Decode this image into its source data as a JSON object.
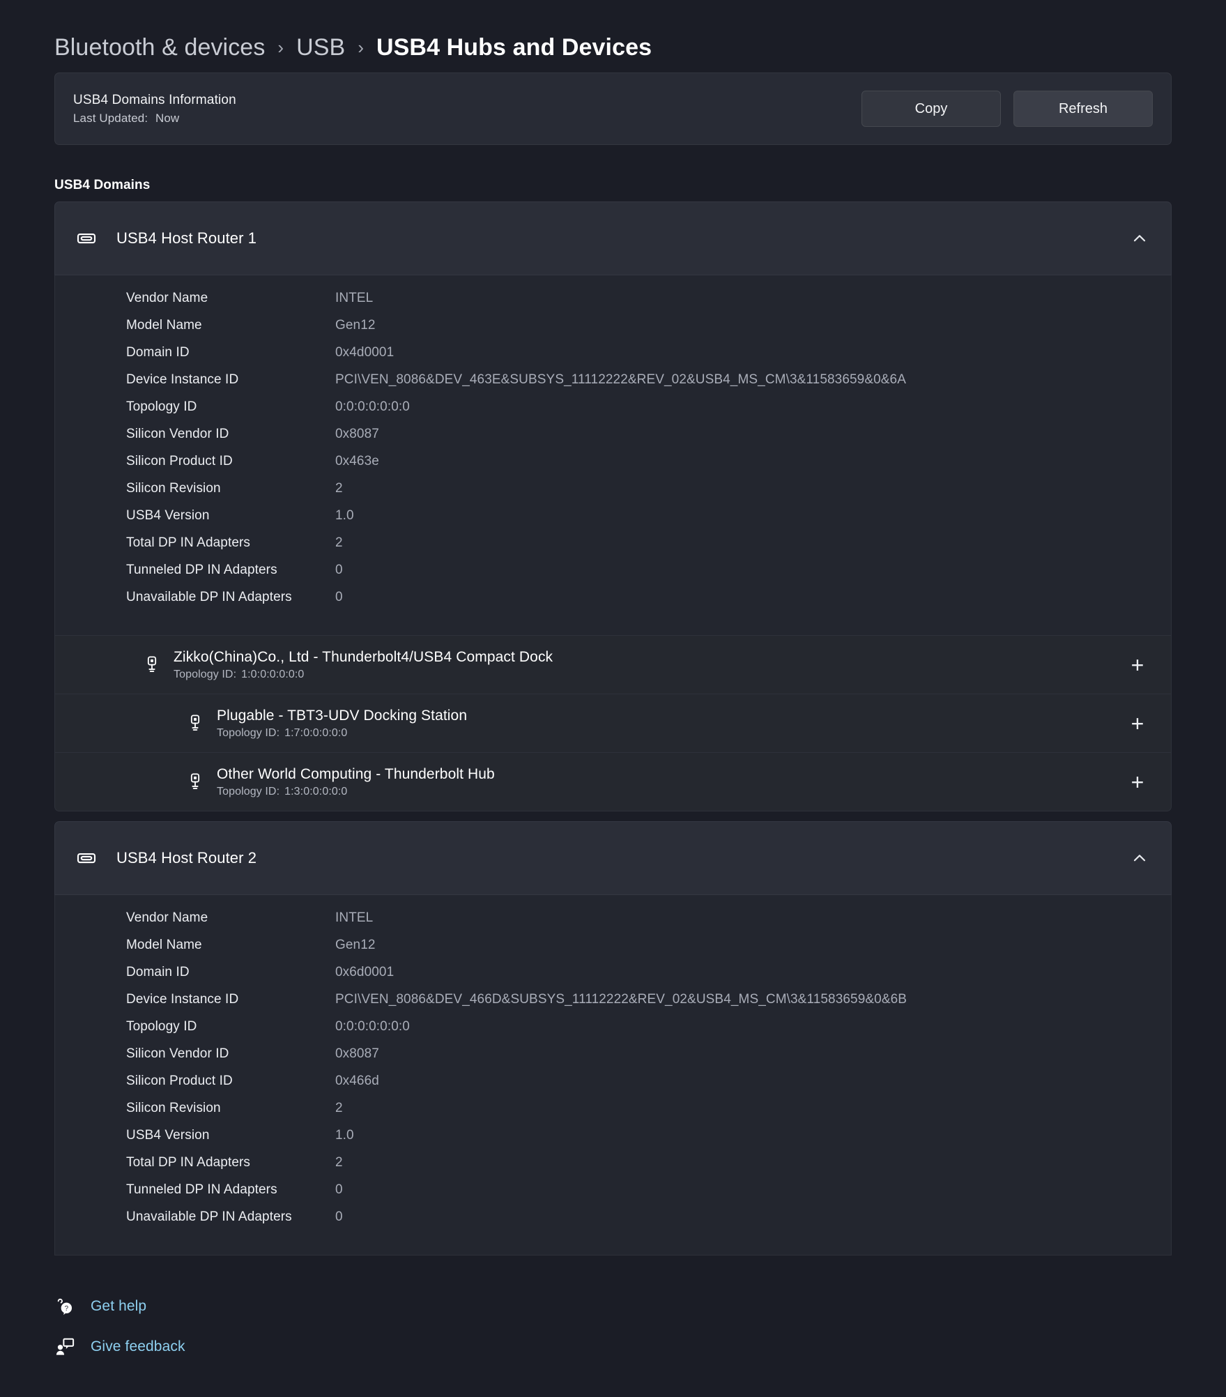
{
  "breadcrumb": {
    "items": [
      {
        "label": "Bluetooth & devices",
        "current": false
      },
      {
        "label": "USB",
        "current": false
      },
      {
        "label": "USB4 Hubs and Devices",
        "current": true
      }
    ],
    "separator": "›"
  },
  "info_card": {
    "title": "USB4 Domains Information",
    "last_updated_label": "Last Updated:",
    "last_updated_value": "Now",
    "copy_button": "Copy",
    "refresh_button": "Refresh"
  },
  "section": {
    "label": "USB4 Domains"
  },
  "routers": [
    {
      "title": "USB4 Host Router 1",
      "icon": "usb-port-icon",
      "expanded": true,
      "details": [
        {
          "key": "Vendor Name",
          "value": "INTEL"
        },
        {
          "key": "Model Name",
          "value": "Gen12"
        },
        {
          "key": "Domain ID",
          "value": "0x4d0001"
        },
        {
          "key": "Device Instance ID",
          "value": "PCI\\VEN_8086&DEV_463E&SUBSYS_11112222&REV_02&USB4_MS_CM\\3&11583659&0&6A"
        },
        {
          "key": "Topology ID",
          "value": "0:0:0:0:0:0:0"
        },
        {
          "key": "Silicon Vendor ID",
          "value": "0x8087"
        },
        {
          "key": "Silicon Product ID",
          "value": "0x463e"
        },
        {
          "key": "Silicon Revision",
          "value": "2"
        },
        {
          "key": "USB4 Version",
          "value": "1.0"
        },
        {
          "key": "Total DP IN Adapters",
          "value": "2"
        },
        {
          "key": "Tunneled DP IN Adapters",
          "value": "0"
        },
        {
          "key": "Unavailable DP IN Adapters",
          "value": "0"
        }
      ],
      "devices": [
        {
          "name": "Zikko(China)Co., Ltd - Thunderbolt4/USB4 Compact Dock",
          "topology_label": "Topology ID:",
          "topology_value": "1:0:0:0:0:0:0",
          "indent": 0,
          "expand_icon": "+"
        },
        {
          "name": "Plugable - TBT3-UDV Docking Station",
          "topology_label": "Topology ID:",
          "topology_value": "1:7:0:0:0:0:0",
          "indent": 1,
          "expand_icon": "+"
        },
        {
          "name": "Other World Computing - Thunderbolt Hub",
          "topology_label": "Topology ID:",
          "topology_value": "1:3:0:0:0:0:0",
          "indent": 1,
          "expand_icon": "+"
        }
      ]
    },
    {
      "title": "USB4 Host Router 2",
      "icon": "usb-port-icon",
      "expanded": true,
      "details": [
        {
          "key": "Vendor Name",
          "value": "INTEL"
        },
        {
          "key": "Model Name",
          "value": "Gen12"
        },
        {
          "key": "Domain ID",
          "value": "0x6d0001"
        },
        {
          "key": "Device Instance ID",
          "value": "PCI\\VEN_8086&DEV_466D&SUBSYS_11112222&REV_02&USB4_MS_CM\\3&11583659&0&6B"
        },
        {
          "key": "Topology ID",
          "value": "0:0:0:0:0:0:0"
        },
        {
          "key": "Silicon Vendor ID",
          "value": "0x8087"
        },
        {
          "key": "Silicon Product ID",
          "value": "0x466d"
        },
        {
          "key": "Silicon Revision",
          "value": "2"
        },
        {
          "key": "USB4 Version",
          "value": "1.0"
        },
        {
          "key": "Total DP IN Adapters",
          "value": "2"
        },
        {
          "key": "Tunneled DP IN Adapters",
          "value": "0"
        },
        {
          "key": "Unavailable DP IN Adapters",
          "value": "0"
        }
      ],
      "devices": []
    }
  ],
  "footer": {
    "links": [
      {
        "label": "Get help",
        "icon": "help-question-icon"
      },
      {
        "label": "Give feedback",
        "icon": "feedback-person-chat-icon"
      }
    ]
  },
  "colors": {
    "page_background": "#1b1d26",
    "card_background": "#282b35",
    "details_background": "#23262f",
    "accent_link": "#8ed0f0",
    "primary_text": "#ffffff",
    "secondary_text": "#a9adb8"
  }
}
